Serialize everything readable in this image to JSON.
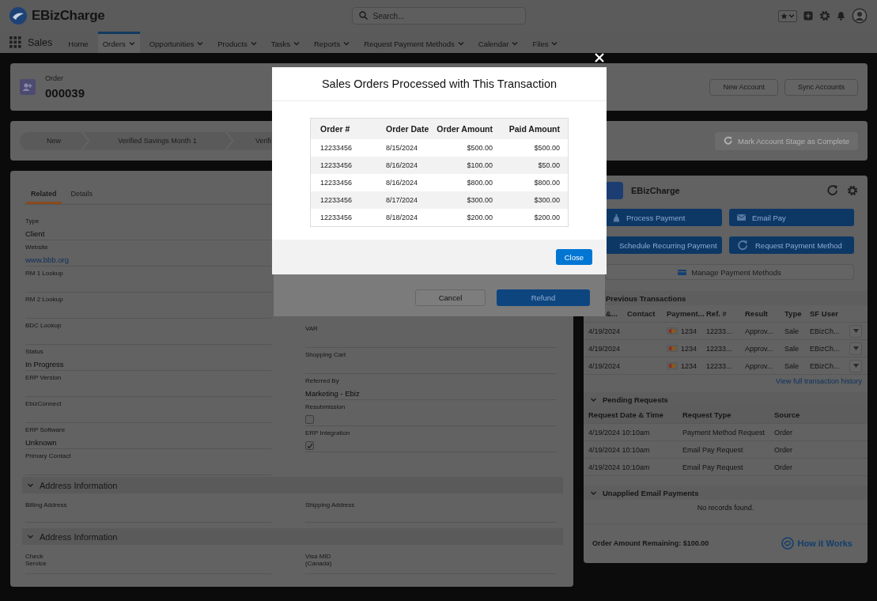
{
  "app": {
    "name": "EBizCharge",
    "search": {
      "placeholder": "Search..."
    }
  },
  "nav": {
    "app_name": "Sales",
    "items": [
      {
        "label": "Home",
        "dropdown": false,
        "selected": false
      },
      {
        "label": "Orders",
        "dropdown": true,
        "selected": true
      },
      {
        "label": "Opportunities",
        "dropdown": true,
        "selected": false
      },
      {
        "label": "Products",
        "dropdown": true,
        "selected": false
      },
      {
        "label": "Tasks",
        "dropdown": true,
        "selected": false
      },
      {
        "label": "Reports",
        "dropdown": true,
        "selected": false
      },
      {
        "label": "Request Payment Methods",
        "dropdown": true,
        "selected": false
      },
      {
        "label": "Calendar",
        "dropdown": true,
        "selected": false
      },
      {
        "label": "Files",
        "dropdown": true,
        "selected": false
      }
    ]
  },
  "record": {
    "type": "Order",
    "number": "000039",
    "actions": [
      "New Account",
      "Sync Accounts"
    ]
  },
  "path": {
    "stages": [
      {
        "label": "New"
      },
      {
        "label": "Verified Savings Month 1"
      },
      {
        "label": "Verifi"
      }
    ],
    "complete_button": {
      "label": "Mark Account Stage as Complete",
      "disabled": true
    }
  },
  "detail": {
    "tabs": [
      {
        "label": "Related",
        "selected": true
      },
      {
        "label": "Details",
        "selected": false
      }
    ],
    "left_fields": [
      {
        "kind": "text",
        "label": "Type",
        "value": "Client"
      },
      {
        "kind": "link",
        "label": "Website",
        "value": "www.bbb.org"
      },
      {
        "kind": "text",
        "label": "RM 1 Lookup"
      },
      {
        "kind": "text",
        "label": "RM 2 Lookup"
      },
      {
        "kind": "text",
        "label": "BDC Lookup"
      },
      {
        "kind": "text",
        "label": "Status",
        "value": "In Progress"
      },
      {
        "kind": "text",
        "label": "ERP Version"
      },
      {
        "kind": "text",
        "label": "EbizConnect"
      },
      {
        "kind": "text",
        "label": "ERP Software",
        "value": "Unknown"
      },
      {
        "kind": "text",
        "label": "Primary Contact"
      }
    ],
    "right_fields": [
      {
        "kind": "text",
        "label": "VAR"
      },
      {
        "kind": "text",
        "label": "Shopping Cart"
      },
      {
        "kind": "text",
        "label": "Referred By",
        "value": "Marketing - Ebiz"
      },
      {
        "kind": "checkbox",
        "label": "Resubmission",
        "checked": false
      },
      {
        "kind": "checkbox",
        "label": "ERP Integration",
        "checked": true
      }
    ],
    "sections": [
      {
        "title": "Address Information",
        "expanded": true,
        "fields": [
          "Billing Address",
          "Shipping Address"
        ]
      },
      {
        "title": "Address Information",
        "expanded": true,
        "fields": [
          "Check Service",
          "Visa MID (Canada)"
        ]
      }
    ]
  },
  "ebiz_panel": {
    "title": "EBizCharge",
    "actions": [
      {
        "label": "Process Payment"
      },
      {
        "label": "Email Pay"
      },
      {
        "label": "Schedule Recurring Payment"
      },
      {
        "label": "Request Payment Method"
      }
    ],
    "manage_button": "Manage Payment Methods",
    "transactions": {
      "title": "Previous Transactions",
      "columns": [
        "&...",
        "Contact",
        "Payment...",
        "Ref. #",
        "Result",
        "Type",
        "SF User"
      ],
      "rows": [
        {
          "date": "4/19/2024",
          "card": "1234",
          "ref": "12233...",
          "result": "Approv...",
          "type": "Sale",
          "user": "EBizCh..."
        },
        {
          "date": "4/19/2024",
          "card": "1234",
          "ref": "12233...",
          "result": "Approv...",
          "type": "Sale",
          "user": "EBizCh..."
        },
        {
          "date": "4/19/2024",
          "card": "1234",
          "ref": "12233...",
          "result": "Approv...",
          "type": "Sale",
          "user": "EBizCh..."
        }
      ],
      "history_link": "View full transaction history"
    },
    "pending": {
      "title": "Pending Requests",
      "expanded": true,
      "columns": [
        "Request Date & Time",
        "Request Type",
        "Source"
      ],
      "rows": [
        [
          "4/19/2024 10:10am",
          "Payment Method Request",
          "Order"
        ],
        [
          "4/19/2024 10:10am",
          "Email Pay Request",
          "Order"
        ],
        [
          "4/19/2024 10:10am",
          "Email Pay Request",
          "Order"
        ]
      ]
    },
    "unapplied": {
      "title": "Unapplied Email Payments",
      "expanded": true,
      "empty_text": "No records found."
    },
    "remaining": "Order Amount Remaining: $100.00",
    "help_link": "How it Works"
  },
  "refund_dialog": {
    "buttons": [
      {
        "label": "Cancel",
        "kind": "neutral"
      },
      {
        "label": "Refund",
        "kind": "brand"
      }
    ]
  },
  "orders_modal": {
    "title": "Sales Orders Processed with This Transaction",
    "columns": [
      "Order #",
      "Order Date",
      "Order Amount",
      "Paid Amount"
    ],
    "rows": [
      [
        "12233456",
        "8/15/2024",
        "$500.00",
        "$500.00"
      ],
      [
        "12233456",
        "8/16/2024",
        "$100.00",
        "$50.00"
      ],
      [
        "12233456",
        "8/16/2024",
        "$800.00",
        "$800.00"
      ],
      [
        "12233456",
        "8/17/2024",
        "$300.00",
        "$300.00"
      ],
      [
        "12233456",
        "8/18/2024",
        "$200.00",
        "$200.00"
      ]
    ],
    "close_button": "Close"
  }
}
